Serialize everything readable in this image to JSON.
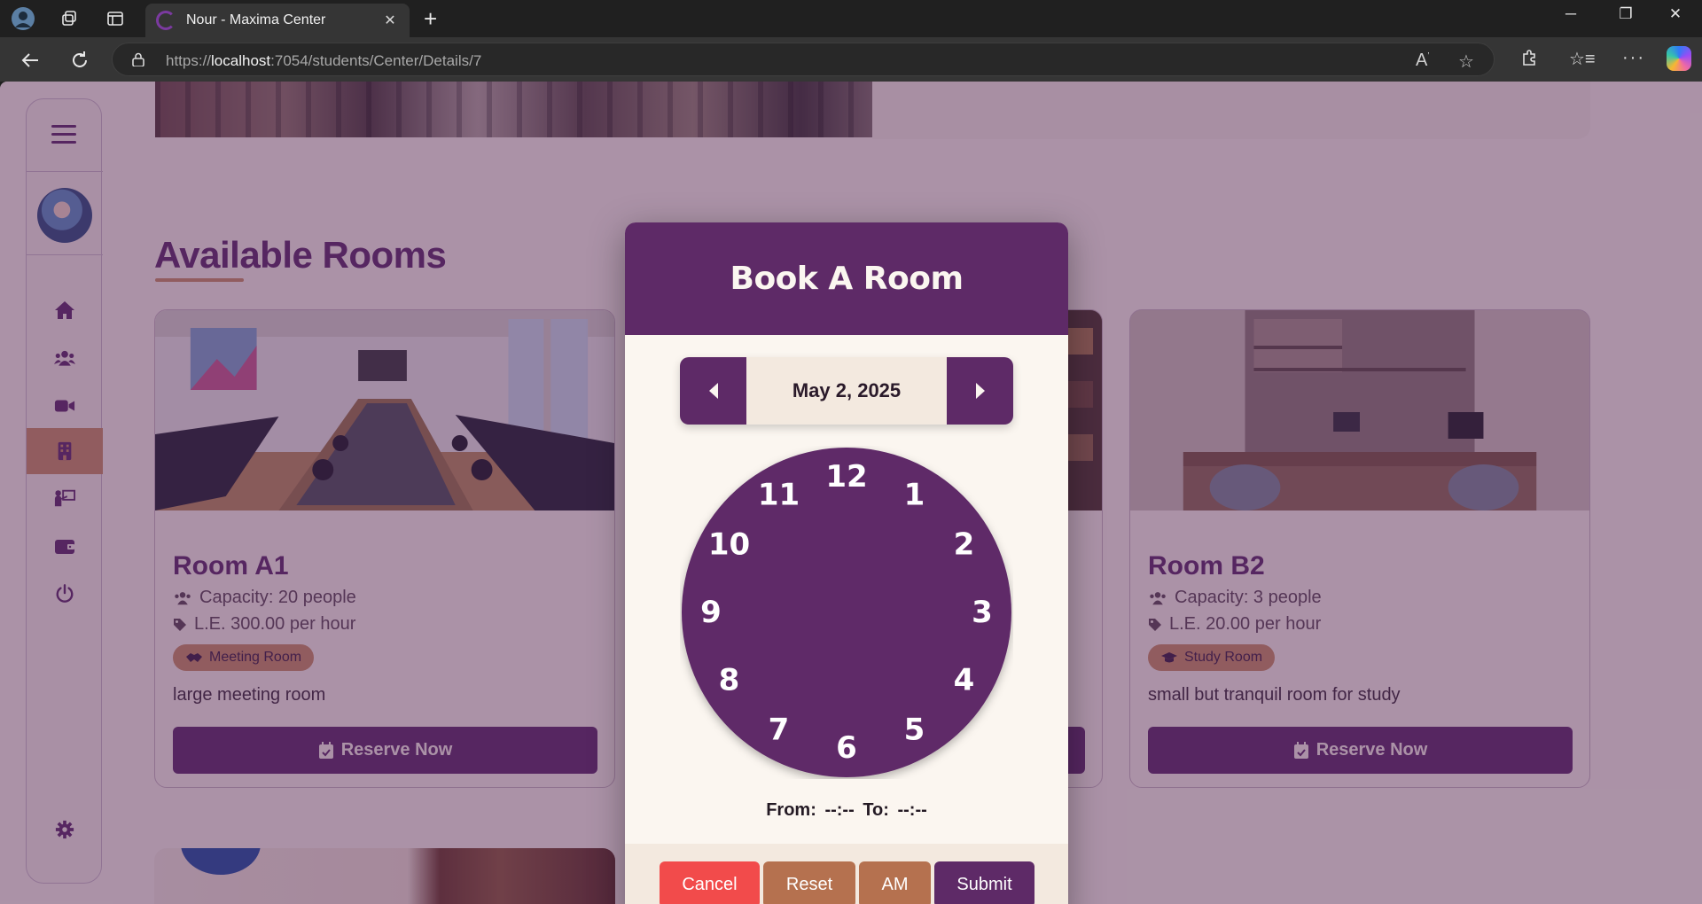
{
  "browser": {
    "tab_title": "Nour - Maxima Center",
    "url_prefix": "https://",
    "url_host": "localhost",
    "url_path": ":7054/students/Center/Details/7"
  },
  "page": {
    "section_title": "Available Rooms",
    "rooms": [
      {
        "name": "Room A1",
        "capacity": "Capacity: 20 people",
        "price": "L.E. 300.00 per hour",
        "badge": "Meeting Room",
        "description": "large meeting room",
        "button": "Reserve Now"
      },
      {
        "name": "Room B2",
        "capacity": "Capacity: 3 people",
        "price": "L.E. 20.00 per hour",
        "badge": "Study Room",
        "description": "small but tranquil room for study",
        "button": "Reserve Now"
      }
    ]
  },
  "modal": {
    "title": "Book A Room",
    "date": "May 2, 2025",
    "clock_numbers": [
      "12",
      "1",
      "2",
      "3",
      "4",
      "5",
      "6",
      "7",
      "8",
      "9",
      "10",
      "11"
    ],
    "from_label": "From:",
    "from_value": "--:--",
    "to_label": "To:",
    "to_value": "--:--",
    "buttons": {
      "cancel": "Cancel",
      "reset": "Reset",
      "ampm": "AM",
      "submit": "Submit"
    }
  },
  "colors": {
    "primary": "#5e2a67",
    "accent": "#c98d63",
    "cream": "#f8efe6",
    "cancel": "#f24b4b",
    "reset": "#b5714f",
    "ampm": "#b5714f"
  },
  "icons": {
    "sidebar": [
      "menu-icon",
      "home-icon",
      "users-icon",
      "video-icon",
      "building-icon",
      "teacher-icon",
      "wallet-icon",
      "power-icon",
      "gear-icon"
    ]
  }
}
